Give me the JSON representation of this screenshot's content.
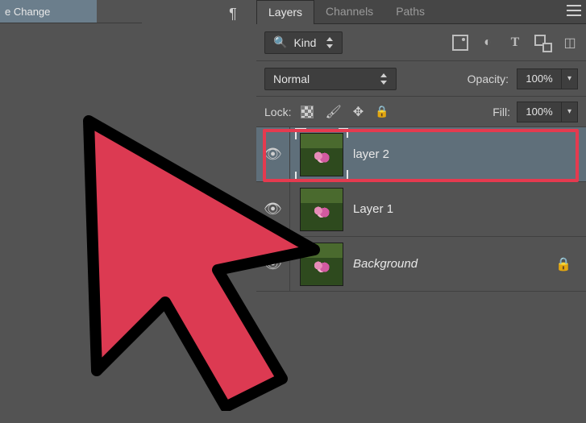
{
  "ui_fragment": {
    "top_left_tab": "e Change"
  },
  "panel": {
    "tabs": {
      "layers": "Layers",
      "channels": "Channels",
      "paths": "Paths"
    },
    "filter": {
      "kind_label": "Kind"
    },
    "blend": {
      "mode": "Normal",
      "opacity_label": "Opacity:",
      "opacity_value": "100%"
    },
    "lock": {
      "label": "Lock:",
      "fill_label": "Fill:",
      "fill_value": "100%"
    },
    "layers": [
      {
        "name": "layer 2",
        "visible": true,
        "selected": true,
        "locked": false,
        "italic": false
      },
      {
        "name": "Layer 1",
        "visible": true,
        "selected": false,
        "locked": false,
        "italic": false
      },
      {
        "name": "Background",
        "visible": true,
        "selected": false,
        "locked": true,
        "italic": true
      }
    ]
  }
}
